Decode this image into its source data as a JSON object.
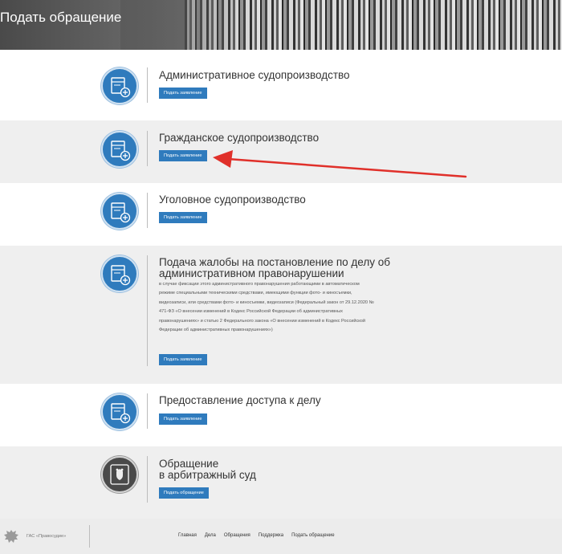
{
  "header": {
    "title": "Подать обращение"
  },
  "rows": [
    {
      "title": "Административное судопроизводство",
      "button": "Подать заявление",
      "icon": "document-plus-icon"
    },
    {
      "title": "Гражданское судопроизводство",
      "button": "Подать заявление",
      "icon": "document-plus-icon"
    },
    {
      "title": "Уголовное судопроизводство",
      "button": "Подать заявление",
      "icon": "document-plus-icon"
    },
    {
      "title_line1": "Подача жалобы на постановление по делу об",
      "title_line2": "административном правонарушении",
      "desc": [
        "в случае фиксации этого административного правонарушения работающими в автоматическом",
        "режиме специальными техническими средствами, имеющими функции фото- и киносъемки,",
        "видеозаписи, или средствами фото- и киносъемки, видеозаписи (Федеральный закон от 29.12.2020 №",
        "471-ФЗ «О внесении изменений в Кодекс Российской Федерации об административных",
        "правонарушениях» и статью 2 Федерального закона «О внесении изменений в Кодекс Российской",
        "Федерации об административных правонарушениях»)"
      ],
      "button": "Подать заявление",
      "icon": "document-plus-icon"
    },
    {
      "title": "Предоставление доступа к делу",
      "button": "Подать заявление",
      "icon": "document-plus-icon"
    },
    {
      "title_line1": "Обращение",
      "title_line2": "в арбитражный суд",
      "button": "Подать обращение",
      "icon": "coat-of-arms-icon"
    }
  ],
  "footer": {
    "brand": "ГАС «Правосудие»",
    "links": [
      "Главная",
      "Дела",
      "Обращения",
      "Поддержка",
      "Подать обращение"
    ]
  },
  "colors": {
    "accent": "#2f7bbd",
    "arrow": "#e0302a",
    "row_gray": "#efefef"
  }
}
